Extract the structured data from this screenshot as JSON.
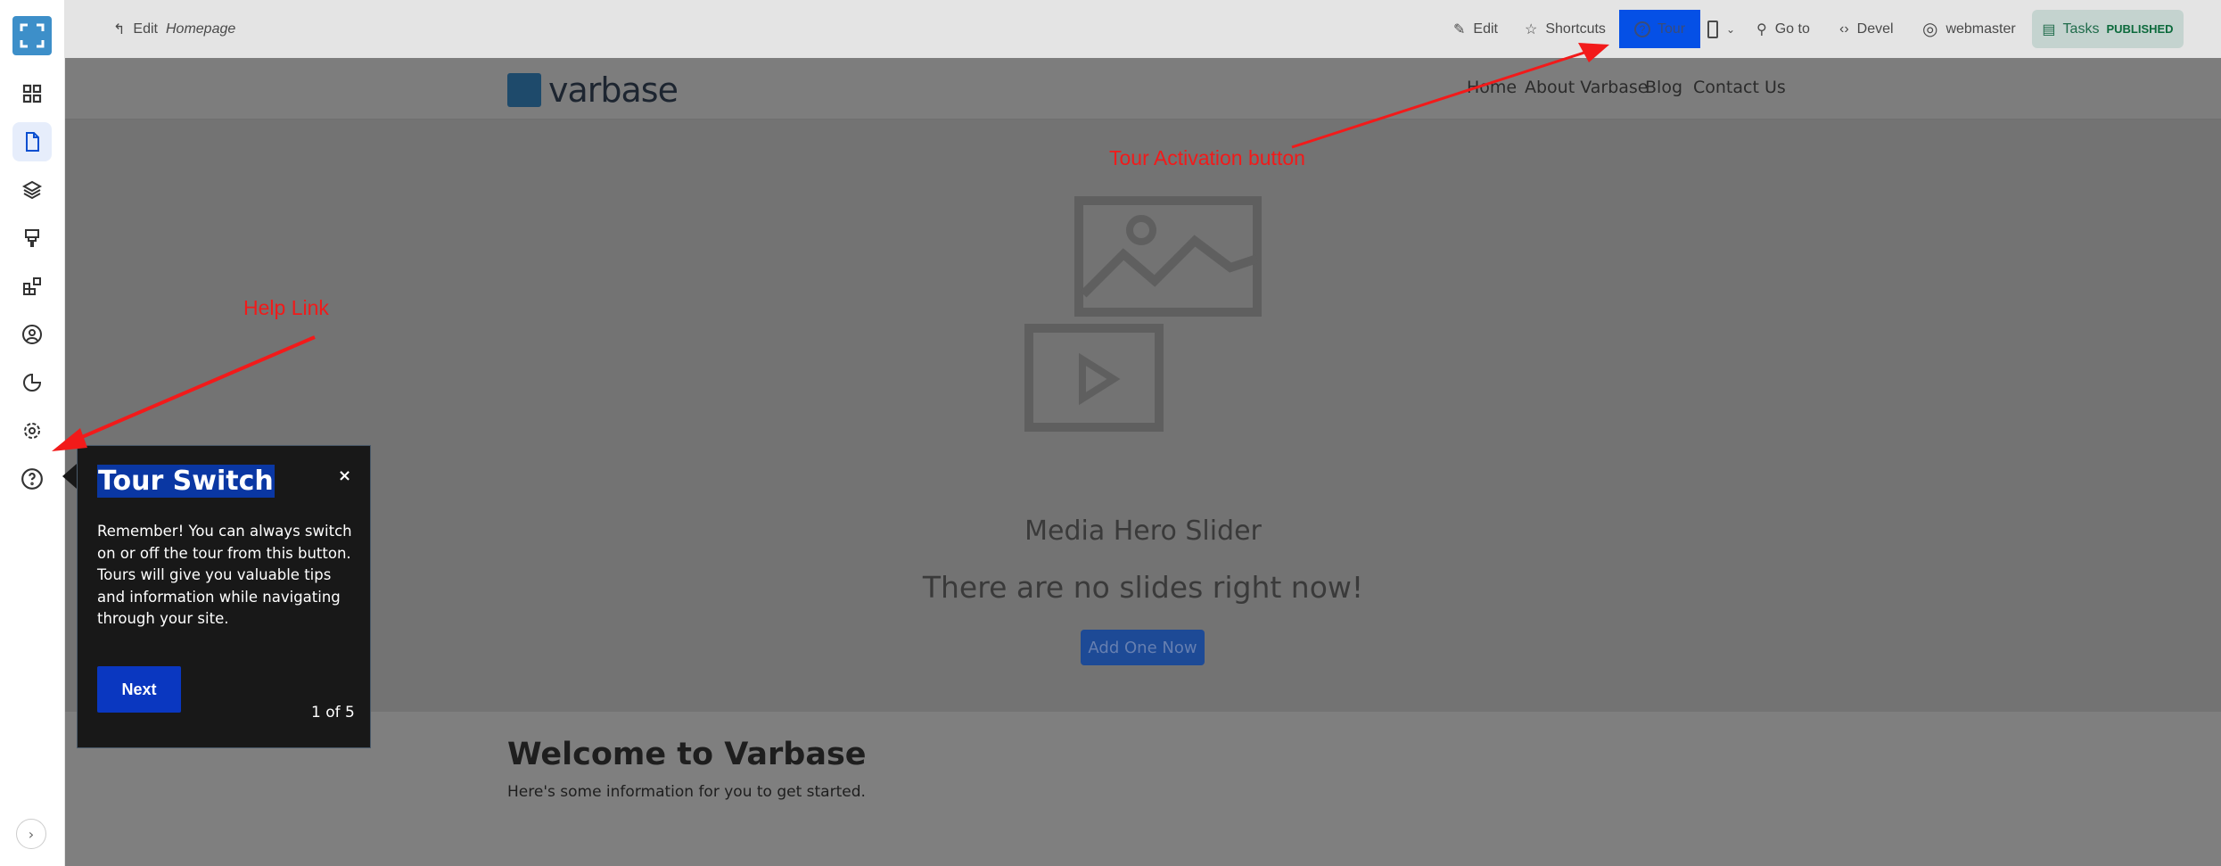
{
  "topbar": {
    "back_label": "Edit",
    "back_page": "Homepage",
    "edit": "Edit",
    "shortcuts": "Shortcuts",
    "tour": "Tour",
    "goto": "Go to",
    "devel": "Devel",
    "user": "webmaster",
    "tasks": "Tasks",
    "status": "PUBLISHED"
  },
  "sidebar": {
    "items": [
      "dashboard-icon",
      "content-icon",
      "structure-icon",
      "appearance-icon",
      "extend-icon",
      "people-icon",
      "reports-icon",
      "configuration-icon",
      "help-icon"
    ]
  },
  "site": {
    "logo": "varbase",
    "nav": [
      "Home",
      "About Varbase",
      "Blog",
      "Contact Us"
    ]
  },
  "hero": {
    "title": "Media Hero Slider",
    "message": "There are no slides right now!",
    "button": "Add One Now"
  },
  "content": {
    "heading": "Welcome to Varbase",
    "intro": "Here's some information for you to get started."
  },
  "tour_tip": {
    "title": "Tour Switch",
    "body": "Remember! You can always switch on or off the tour from this button. Tours will give you valuable tips and information while navigating through your site.",
    "next": "Next",
    "counter": "1 of 5",
    "close": "×"
  },
  "annotations": {
    "tour": "Tour Activation button",
    "help": "Help Link"
  },
  "colors": {
    "accent": "#0550e6",
    "annotation": "#f21a1a"
  }
}
